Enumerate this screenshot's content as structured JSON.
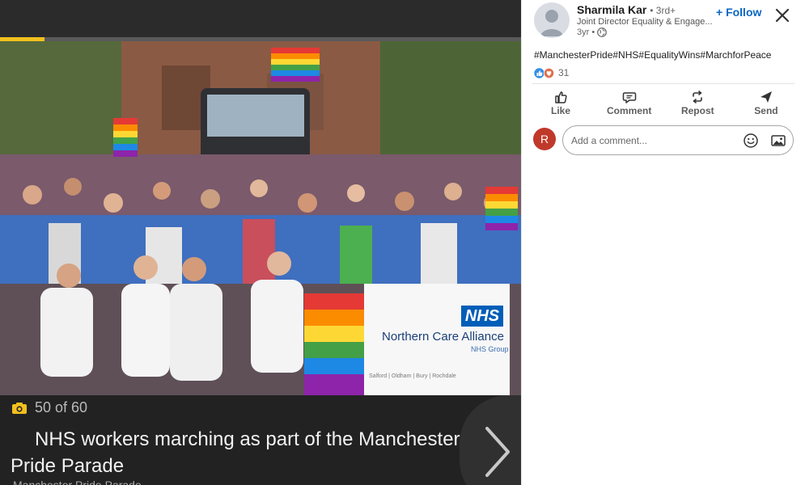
{
  "gallery": {
    "progress": 0.085,
    "counter": "50 of 60",
    "caption": "NHS workers marching as part of the Manchester Pride Parade",
    "caption_sub": "Manchester Pride Parade",
    "banner_nhs": "NHS",
    "banner_name": "Northern Care Alliance",
    "banner_group": "NHS Group",
    "banner_towns": "Salford | Oldham | Bury | Rochdale",
    "accent_color": "#f2c01d",
    "icons": {
      "counter": "camera-icon",
      "next": "chevron-right-icon"
    }
  },
  "post": {
    "author_name": "Sharmila Kar",
    "degree": "• 3rd+",
    "author_title": "Joint Director Equality & Engage...",
    "time": "3yr •",
    "follow_label": "+ Follow",
    "hashtags": "#ManchesterPride#NHS#EqualityWins#MarchforPeace",
    "reaction_count": "31",
    "actions": [
      {
        "label": "Like",
        "icon": "thumbs-up-icon"
      },
      {
        "label": "Comment",
        "icon": "comment-icon"
      },
      {
        "label": "Repost",
        "icon": "repost-icon"
      },
      {
        "label": "Send",
        "icon": "send-icon"
      }
    ],
    "user_initial": "R",
    "comment_placeholder": "Add a comment...",
    "brand_color": "#0a66c2"
  }
}
